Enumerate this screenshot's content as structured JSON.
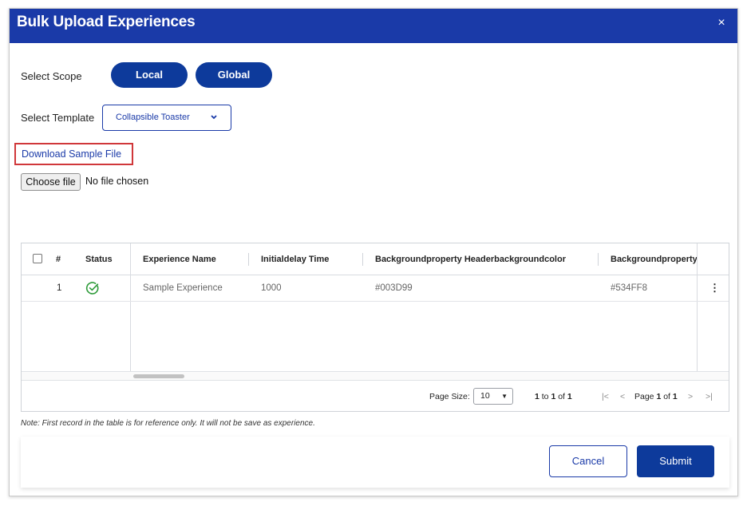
{
  "modal": {
    "title": "Bulk Upload Experiences",
    "close_glyph": "×"
  },
  "scope": {
    "label": "Select Scope",
    "options": [
      "Local",
      "Global"
    ]
  },
  "template": {
    "label": "Select Template",
    "selected": "Collapsible Toaster",
    "chevron": "⌄"
  },
  "download": {
    "label": "Download Sample File"
  },
  "file": {
    "button_label": "Choose file",
    "status": "No file chosen"
  },
  "table": {
    "columns": [
      "#",
      "Status",
      "Experience Name",
      "Initialdelay Time",
      "Backgroundproperty Headerbackgroundcolor",
      "Backgroundproperty"
    ],
    "rows": [
      {
        "num": "1",
        "status": "valid",
        "name": "Sample Experience",
        "delay": "1000",
        "headerbg": "#003D99",
        "bg": "#534FF8",
        "menu": "⋮"
      }
    ]
  },
  "pager": {
    "page_size_label": "Page Size:",
    "page_size_value": "10",
    "range": "1 to 1 of 1",
    "range_parts": {
      "from": "1",
      "to_word": "to",
      "to": "1",
      "of_word": "of",
      "total": "1"
    },
    "page_word": "Page",
    "page": "1",
    "of_word": "of",
    "pages": "1",
    "first_glyph": "|<",
    "prev_glyph": "<",
    "next_glyph": ">",
    "last_glyph": ">|"
  },
  "note": "Note: First record in the table is for reference only. It will not be save as experience.",
  "buttons": {
    "cancel": "Cancel",
    "submit": "Submit"
  },
  "colors": {
    "header_bg": "#1a3aa8",
    "primary": "#0d3a9b",
    "highlight_border": "#d0373a",
    "status_ok": "#2e9b3a"
  },
  "icons": {
    "status_ok": "check-circle-icon",
    "close": "close-icon",
    "menu": "kebab-menu-icon"
  }
}
